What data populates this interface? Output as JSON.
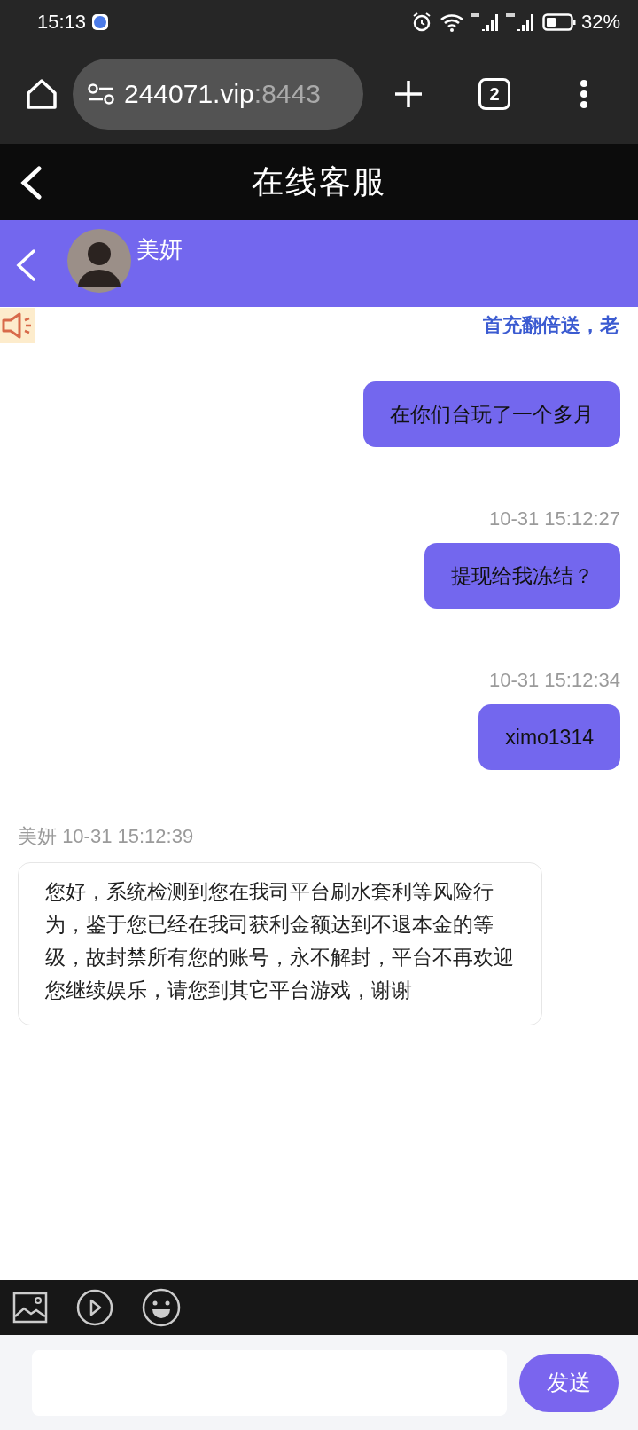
{
  "status_bar": {
    "time": "15:13",
    "battery": "32%"
  },
  "browser": {
    "url_host": "244071.vip",
    "url_port": ":8443",
    "tab_count": "2"
  },
  "page": {
    "title": "在线客服"
  },
  "chat_header": {
    "agent_name": "美妍"
  },
  "notice": {
    "text": "首充翻倍送，老"
  },
  "messages": [
    {
      "kind": "sent",
      "text": "在你们台玩了一个多月"
    },
    {
      "kind": "sent",
      "time": "10-31 15:12:27",
      "text": "提现给我冻结？"
    },
    {
      "kind": "sent",
      "time": "10-31 15:12:34",
      "text": "ximo1314"
    },
    {
      "kind": "received",
      "sender": "美妍",
      "time": "10-31 15:12:39",
      "text": "您好，系统检测到您在我司平台刷水套利等风险行为，鉴于您已经在我司获利金额达到不退本金的等级，故封禁所有您的账号，永不解封，平台不再欢迎您继续娱乐，请您到其它平台游戏，谢谢"
    }
  ],
  "composer": {
    "send_button": "发送"
  }
}
